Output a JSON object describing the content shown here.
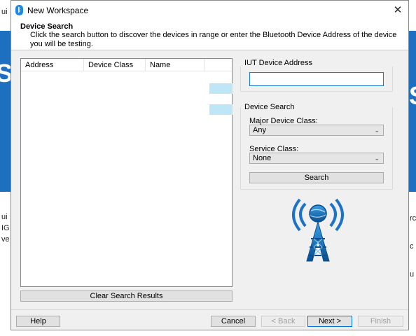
{
  "background_app": {
    "fragments": [
      "ui",
      "ui",
      "IG",
      "ve",
      "rc",
      "c",
      "u",
      "S",
      "S"
    ]
  },
  "dialog": {
    "title": "New Workspace",
    "close_glyph": "✕",
    "header": {
      "title": "Device Search",
      "description": "Click the search button to discover the devices in range or enter the Bluetooth Device Address of the device you will be testing."
    },
    "device_table": {
      "columns": [
        "Address",
        "Device Class",
        "Name"
      ]
    },
    "clear_button_label": "Clear Search Results",
    "iut_section": {
      "label": "IUT Device Address",
      "value": ""
    },
    "device_search": {
      "label": "Device Search",
      "major_class_label": "Major Device Class:",
      "major_class_value": "Any",
      "service_class_label": "Service Class:",
      "service_class_value": "None",
      "search_button_label": "Search"
    },
    "buttons": {
      "help": "Help",
      "cancel": "Cancel",
      "back": "< Back",
      "next": "Next >",
      "finish": "Finish"
    }
  },
  "icons": {
    "title": "bluetooth-icon",
    "logo": "bluetooth-tower-logo-icon",
    "dropdown": "chevron-down-icon"
  },
  "colors": {
    "accent": "#0078d7",
    "background_blue": "#1d6fbf",
    "row_highlight": "#bfe6f7"
  }
}
